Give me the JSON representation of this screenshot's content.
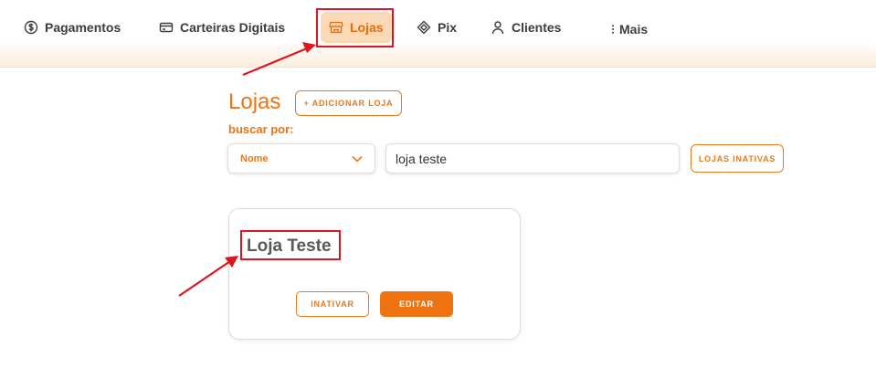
{
  "nav": {
    "items": [
      {
        "label": "Pagamentos",
        "icon": "dollar-circle-icon"
      },
      {
        "label": "Carteiras Digitais",
        "icon": "wallet-card-icon"
      },
      {
        "label": "Lojas",
        "icon": "store-icon",
        "active": true
      },
      {
        "label": "Pix",
        "icon": "pix-diamond-icon"
      },
      {
        "label": "Clientes",
        "icon": "user-icon"
      },
      {
        "label": "Mais",
        "icon": "kebab-menu-icon"
      }
    ]
  },
  "page": {
    "title": "Lojas",
    "add_button_label": "+ ADICIONAR LOJA",
    "search_by_label": "buscar por:",
    "filter_selected": "Nome",
    "search_value": "loja teste",
    "inactive_button_label": "LOJAS INATIVAS"
  },
  "card": {
    "title": "Loja Teste",
    "deactivate_label": "INATIVAR",
    "edit_label": "EDITAR"
  },
  "colors": {
    "accent": "#ee7311",
    "annotation": "#e0141e",
    "active_tab_bg": "#fcd9b6"
  }
}
